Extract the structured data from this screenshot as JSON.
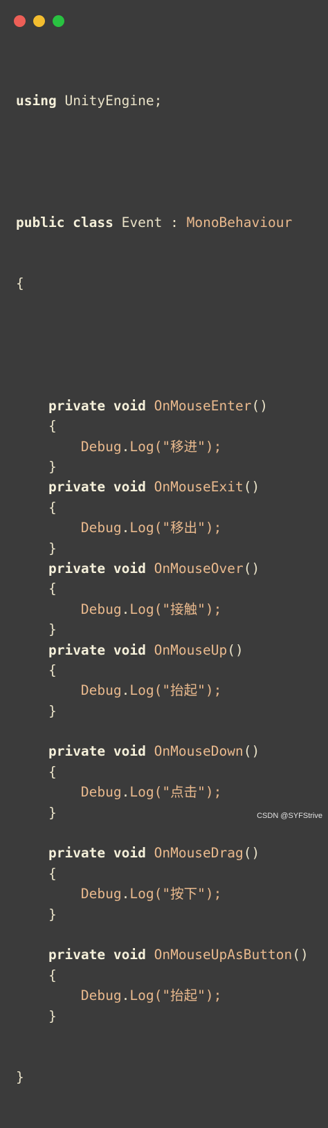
{
  "window": {
    "controls": {
      "close_color": "#ed5f57",
      "minimize_color": "#f3bd2f",
      "maximize_color": "#29c241"
    }
  },
  "code": {
    "using_kw": "using",
    "using_ns": "UnityEngine",
    "using_end": ";",
    "class_kw": "public class",
    "class_name": "Event",
    "class_colon": ":",
    "class_base": "MonoBehaviour",
    "class_open": "{",
    "class_close": "}",
    "methods": [
      {
        "modifiers": "private void",
        "name": "OnMouseEnter",
        "parens": "()",
        "open": "{",
        "call_obj": "Debug",
        "call_dot": ".",
        "call_fn": "Log",
        "call_args": "(\"移进\");",
        "close": "}"
      },
      {
        "modifiers": "private void",
        "name": "OnMouseExit",
        "parens": "()",
        "open": "{",
        "call_obj": "Debug",
        "call_dot": ".",
        "call_fn": "Log",
        "call_args": "(\"移出\");",
        "close": "}"
      },
      {
        "modifiers": "private void",
        "name": "OnMouseOver",
        "parens": "()",
        "open": "{",
        "call_obj": "Debug",
        "call_dot": ".",
        "call_fn": "Log",
        "call_args": "(\"接触\");",
        "close": "}"
      },
      {
        "modifiers": "private void",
        "name": "OnMouseUp",
        "parens": "()",
        "open": "{",
        "call_obj": "Debug",
        "call_dot": ".",
        "call_fn": "Log",
        "call_args": "(\"抬起\");",
        "close": "}"
      },
      {
        "modifiers": "private void",
        "name": "OnMouseDown",
        "parens": "()",
        "open": "{",
        "call_obj": "Debug",
        "call_dot": ".",
        "call_fn": "Log",
        "call_args": "(\"点击\");",
        "close": "}"
      },
      {
        "modifiers": "private void",
        "name": "OnMouseDrag",
        "parens": "()",
        "open": "{",
        "call_obj": "Debug",
        "call_dot": ".",
        "call_fn": "Log",
        "call_args": "(\"按下\");",
        "close": "}"
      },
      {
        "modifiers": "private void",
        "name": "OnMouseUpAsButton",
        "parens": "()",
        "open": "{",
        "call_obj": "Debug",
        "call_dot": ".",
        "call_fn": "Log",
        "call_args": "(\"抬起\");",
        "close": "}"
      }
    ]
  },
  "watermark": "CSDN @SYFStrive"
}
